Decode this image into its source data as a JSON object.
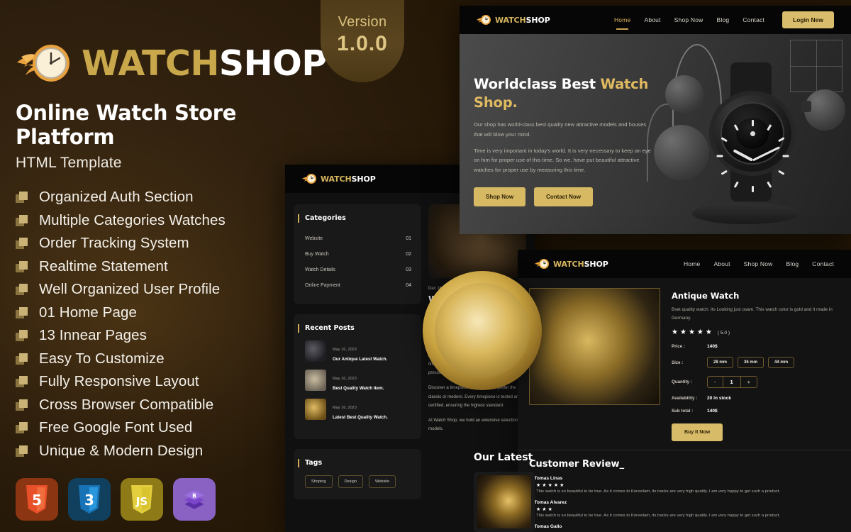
{
  "promo": {
    "brand": {
      "first": "WATCH",
      "second": "SHOP"
    },
    "headline": "Online Watch Store Platform",
    "subheadline": "HTML Template",
    "features": [
      "Organized Auth Section",
      "Multiple Categories Watches",
      "Order Tracking System",
      "Realtime Statement",
      "Well Organized User Profile",
      "01 Home Page",
      "13 Innear Pages",
      "Easy To Customize",
      "Fully Responsive Layout",
      "Cross Browser Compatible",
      "Free Google Font Used",
      "Unique & Modern Design"
    ],
    "tech_badges": [
      {
        "name": "html5-badge",
        "label": "5"
      },
      {
        "name": "css3-badge",
        "label": "3"
      },
      {
        "name": "javascript-badge",
        "label": "JS"
      },
      {
        "name": "bootstrap-badge",
        "label": "B"
      }
    ]
  },
  "version": {
    "label": "Version",
    "number": "1.0.0"
  },
  "nav": {
    "links": [
      "Home",
      "About",
      "Shop Now",
      "Blog",
      "Contact"
    ],
    "cta": "Login New"
  },
  "hero": {
    "title_part1": "Worldclass Best ",
    "title_gold1": "Watch",
    "title_gold2": "Shop.",
    "paragraph1": "Our shop has world-class best quality new attractive models and houses that will blow your mind.",
    "paragraph2": "Time is very important in today's world. It is very necessary to keep an eye on him for proper use of this time. So we, have put beautiful attractive watches for proper use by measuring this time.",
    "btn_primary": "Shop Now",
    "btn_secondary": "Contact Now"
  },
  "blog": {
    "categories_title": "Categories",
    "categories": [
      {
        "name": "Website",
        "num": "01"
      },
      {
        "name": "Buy Watch",
        "num": "02"
      },
      {
        "name": "Watch Details",
        "num": "03"
      },
      {
        "name": "Online Payment",
        "num": "04"
      }
    ],
    "recent_title": "Recent Posts",
    "recent_posts": [
      {
        "date": "May 16, 2023",
        "title": "Our Antique Latest Watch."
      },
      {
        "date": "May 16, 2023",
        "title": "Best Quality Watch Item."
      },
      {
        "date": "May 16, 2023",
        "title": "Latest Best Quality Watch."
      }
    ],
    "tags_title": "Tags",
    "tags": [
      "Shoping",
      "Design",
      "Website"
    ],
    "post_date": "Dec 16, 2023",
    "post_title": "Worldclass",
    "post_paragraphs": [
      "Welcome to Watch Shop, where craftsmanship meets elegance. Each reflection of timeless style in our curated collection, designed to elevate your every moment.",
      "At Watch Shop, our artisans have mastered the finest traditions of craftsmanship, producing precise watches and exquisite detail.",
      "Discover a timepiece that suits you, prefer the classic or modern. Every timepiece is tested and certified, ensuring the highest standard.",
      "At Watch Shop, we hold an extensive selection of models."
    ]
  },
  "latest": {
    "heading": "Our Latest"
  },
  "product": {
    "name": "Antique Watch",
    "description": "Bset quality watch. Its Looking just osam. This watch color is gold and it made in Germany.",
    "rating_value": "( 5.0 )",
    "rating_stars": 5,
    "price_label": "Price :",
    "price_value": "140$",
    "size_label": "Size :",
    "sizes": [
      "28 mm",
      "36 mm",
      "44 mm"
    ],
    "qty_label": "Quantity :",
    "qty_minus": "-",
    "qty_value": "1",
    "qty_plus": "+",
    "availability_label": "Availability :",
    "availability_value": "20 In stock",
    "subtotal_label": "Sub total :",
    "subtotal_value": "140$",
    "buy_label": "Buy It Now",
    "review_heading": "Customer Review_",
    "reviews": [
      {
        "name": "1. Tomas Linas",
        "stars": 5,
        "text": "This watch is so beautiful to be true. As it comes to Koresilam, its tracks are very high quality. I am very happy to get such a product."
      },
      {
        "name": "2. Tomas Alvarez",
        "stars": 3,
        "text": "This watch is so beautiful to be true. As it comes to Koresilam, its tracks are very high quality. I am very happy to get such a product."
      },
      {
        "name": "3. Tomas Galio",
        "stars": 0,
        "text": ""
      }
    ]
  },
  "colors": {
    "background": "#2a1b0b",
    "gold": "#d7b964",
    "gold_text": "#c9a84c",
    "panel": "#121212"
  }
}
